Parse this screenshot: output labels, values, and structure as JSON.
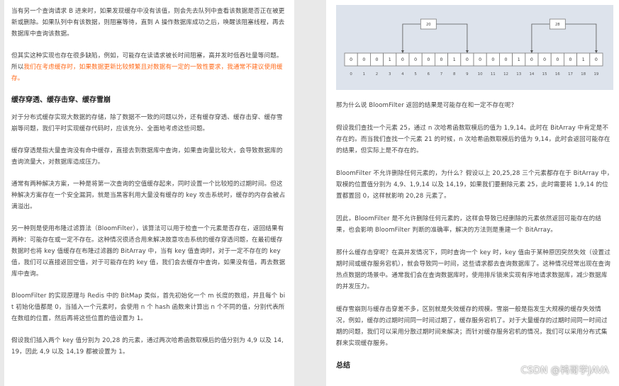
{
  "left": {
    "p1": "当有另一个查询请求 B 进来时，如果发现缓存中没有该值，则会先去队列中查看该数据是否正在被更新或删除。如果队列中有该数据，则阻塞等待，直到 A 操作数据库成功之后，唤醒该阻塞线程，再去数据库中查询该数据。",
    "p2_start": "但其实这种实现也存在很多缺陷，例如，可能存在读请求被长时间阻塞，高并发时低吞吐量等问题。所以",
    "p2_highlight": "我们在考虑缓存时，如果数据更新比较频繁且对数据有一定的一致性要求，我通常不建议使用缓存。",
    "heading": "缓存穿透、缓存击穿、缓存雪崩",
    "p3": "对于分布式缓存实现大数据的存储，除了数据不一致的问题以外，还有缓存穿透、缓存击穿、缓存雪崩等问题，我们平时实现缓存代码时，应该充分、全面地考虑这些问题。",
    "p4": "缓存穿透是指大量查询没有命中缓存，直接去到数据库中查询，如果查询量比较大，会导致数据库的查询流量大，对数据库造成压力。",
    "p5": "通常有两种解决方案，一种是将第一次查询的空值缓存起来，同时设置一个比较短的过期时间。但这种解决方案存在一个安全漏洞，就是当黑客利用大量没有缓存的 key 攻击系统时，缓存的内存会被占满溢出。",
    "p6": "另一种则是使用布隆过滤算法（BloomFilter），该算法可以用于检查一个元素是否存在，返回结果有两种：可能存在或一定不存在。这种情况很适合用来解决故意攻击系统的缓存穿透问题，在最初缓存数据时也将 key 值缓存在布隆过滤器的 BitArray 中，当有 key 值查询时，对于一定不存在的 key 值，我们可以直接返回空值，对于可能存在的 key 值，我们会去缓存中查询，如果没有值，再去数据库中查询。",
    "p7": "BloomFilter 的实现原理与 Redis 中的 BitMap 类似，首先初始化一个 m 长度的数组，并且每个 bit 初始化值都是 0，当插入一个元素时，会使用 n 个 hash 函数来计算出 n 个不同的值，分别代表所在数组的位置，然后再将这些位置的值设置为 1。",
    "p8": "假设我们插入两个 key 值分别为 20,28 的元素，通过两次哈希函数取模后的值分别为 4,9 以及 14,19，因此 4,9 以及 14,19 都被设置为 1。"
  },
  "figure": {
    "bits": [
      "0",
      "0",
      "0",
      "1",
      "0",
      "0",
      "0",
      "0",
      "1",
      "0",
      "0",
      "0",
      "0",
      "1",
      "0",
      "0",
      "0",
      "0",
      "1",
      "0"
    ],
    "indices": [
      "0",
      "1",
      "2",
      "3",
      "4",
      "5",
      "6",
      "7",
      "8",
      "9",
      "10",
      "11",
      "12",
      "13",
      "14",
      "15",
      "16",
      "17",
      "18",
      "19"
    ],
    "key_left": "20",
    "key_right": "28"
  },
  "right": {
    "p1": "那为什么说 BloomFilter 返回的结果是可能存在和一定不存在呢？",
    "p2": "假设我们查找一个元素 25，通过 n 次哈希函数取模后的值为 1,9,14。此时在 BitArray 中肯定是不存在的。而当我们查找一个元素 21 的时候，n 次哈希函数取模后的值为 9,14，此时会返回可能存在的结果，但实际上是不存在的。",
    "p3": "BloomFilter 不允许删除任何元素的，为什么？假设以上 20,25,28 三个元素都存在于 BitArray 中，取模的位置值分别为 4,9、1,9,14 以及 14,19，如果我们要删除元素 25，此时需要将 1,9,14 的位置都置回 0，这样就影响 20,28 元素了。",
    "p4": "因此，BloomFilter 是不允许删除任何元素的，这样会导致已经删除的元素依然返回可能存在的结果，也会影响 BloomFilter 判断的准确率，解决的方法则是重建一个 BitArray。",
    "p5": "那什么缓存击穿呢？在高并发情况下，同时查询一个 key 时，key 值由于某种原因突然失效（设置过期时间或缓存服务宕机），就会导致同一时间，这些请求都去查询数据库了。这种情况经常出现在查询热点数据的场景中。通常我们会在查询数据库时，使用排斥锁来实现有序地请求数据库，减少数据库的并发压力。",
    "p6": "缓存雪崩则与缓存击穿差不多，区别就是失效缓存的规模。雪崩一般是指发生大规模的缓存失效情况，例如，缓存的过期时间同一时间过期了，缓存服务宕机了。对于大量缓存的过期时间同一时间过期的问题，我们可以采用分散过期时间来解决；而针对缓存服务宕机的情况，我们可以采用分布式集群来实现缓存服务。",
    "heading": "总结"
  },
  "watermark": "CSDN @鸨哥学JAVA"
}
